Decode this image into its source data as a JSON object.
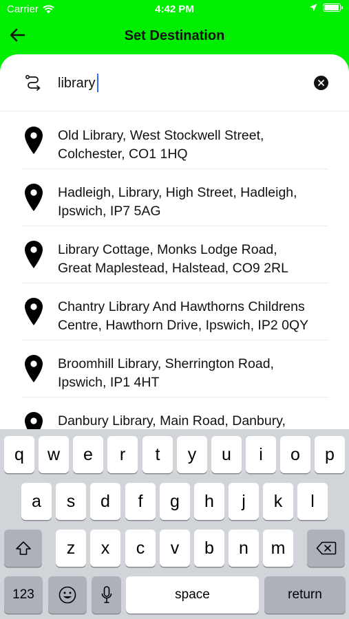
{
  "status_bar": {
    "carrier": "Carrier",
    "time": "4:42 PM",
    "battery_level": 0.95
  },
  "nav": {
    "title": "Set Destination",
    "back_icon": "arrow-left-icon"
  },
  "search": {
    "value": "library",
    "route_icon": "route-icon",
    "clear_icon": "close-circle-icon"
  },
  "results": [
    {
      "line1": "Old Library, West Stockwell Street,",
      "line2": "Colchester, CO1 1HQ"
    },
    {
      "line1": "Hadleigh, Library, High Street, Hadleigh,",
      "line2": "Ipswich, IP7 5AG"
    },
    {
      "line1": "Library Cottage, Monks Lodge Road,",
      "line2": "Great Maplestead, Halstead, CO9 2RL"
    },
    {
      "line1": "Chantry Library And Hawthorns Childrens",
      "line2": "Centre, Hawthorn Drive, Ipswich, IP2 0QY"
    },
    {
      "line1": "Broomhill Library, Sherrington Road,",
      "line2": "Ipswich, IP1 4HT"
    },
    {
      "line1": "Danbury Library, Main Road, Danbury,",
      "line2": ""
    }
  ],
  "keyboard": {
    "row1": [
      "q",
      "w",
      "e",
      "r",
      "t",
      "y",
      "u",
      "i",
      "o",
      "p"
    ],
    "row2": [
      "a",
      "s",
      "d",
      "f",
      "g",
      "h",
      "j",
      "k",
      "l"
    ],
    "row3": [
      "z",
      "x",
      "c",
      "v",
      "b",
      "n",
      "m"
    ],
    "numbers_label": "123",
    "space_label": "space",
    "return_label": "return"
  },
  "colors": {
    "accent_green": "#00ee00",
    "caret_blue": "#2d6cf6"
  }
}
